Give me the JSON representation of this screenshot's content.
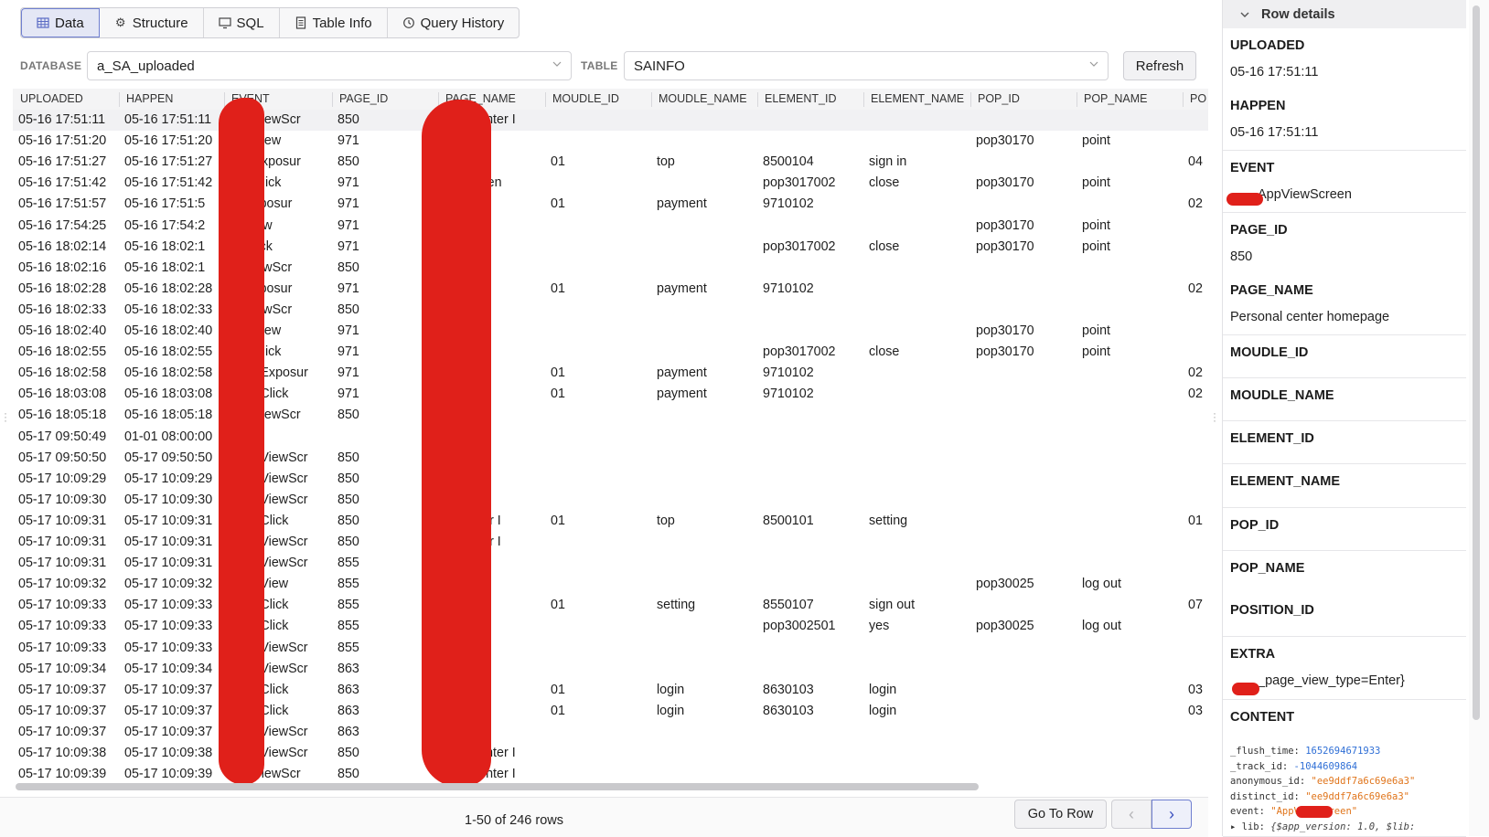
{
  "tabs": [
    {
      "label": "Data",
      "icon": "table-grid-icon"
    },
    {
      "label": "Structure",
      "icon": "gear-icon"
    },
    {
      "label": "SQL",
      "icon": "monitor-icon"
    },
    {
      "label": "Table Info",
      "icon": "document-icon"
    },
    {
      "label": "Query History",
      "icon": "history-icon"
    }
  ],
  "filters": {
    "database_label": "DATABASE",
    "database_value": "a_SA_uploaded",
    "table_label": "TABLE",
    "table_value": "SAINFO",
    "refresh_label": "Refresh"
  },
  "columns": [
    "UPLOADED",
    "HAPPEN",
    "EVENT",
    "PAGE_ID",
    "PAGE_NAME",
    "MOUDLE_ID",
    "MOUDLE_NAME",
    "ELEMENT_ID",
    "ELEMENT_NAME",
    "POP_ID",
    "POP_NAME",
    "PO"
  ],
  "rows": [
    [
      "05-16 17:51:11",
      "05-16 17:51:11",
      "AppViewScr",
      "850",
      "onal center I",
      "",
      "",
      "",
      "",
      "",
      "",
      ""
    ],
    [
      "05-16 17:51:20",
      "05-16 17:51:20",
      "PopView",
      "971",
      "payme",
      "",
      "",
      "",
      "",
      "pop30170",
      "point",
      ""
    ],
    [
      "05-16 17:51:27",
      "05-16 17:51:27",
      "AppExposur",
      "850",
      "center I",
      "01",
      "top",
      "8500104",
      "sign in",
      "",
      "",
      "04"
    ],
    [
      "05-16 17:51:42",
      "05-16 17:51:42",
      "PopClick",
      "971",
      "rt paymen",
      "",
      "",
      "pop3017002",
      "close",
      "pop30170",
      "point",
      ""
    ],
    [
      "05-16 17:51:57",
      "05-16 17:51:5",
      "ppExposur",
      "971",
      "paymen",
      "01",
      "payment",
      "9710102",
      "",
      "",
      "",
      "02"
    ],
    [
      "05-16 17:54:25",
      "05-16 17:54:2",
      "opView",
      "971",
      "aymen",
      "",
      "",
      "",
      "",
      "pop30170",
      "point",
      ""
    ],
    [
      "05-16 18:02:14",
      "05-16 18:02:1",
      "opClick",
      "971",
      "aymen",
      "",
      "",
      "pop3017002",
      "close",
      "pop30170",
      "point",
      ""
    ],
    [
      "05-16 18:02:16",
      "05-16 18:02:1",
      "ppViewScr",
      "850",
      "enter I",
      "",
      "",
      "",
      "",
      "",
      "",
      ""
    ],
    [
      "05-16 18:02:28",
      "05-16 18:02:28",
      "opExposur",
      "971",
      "paymen",
      "01",
      "payment",
      "9710102",
      "",
      "",
      "",
      "02"
    ],
    [
      "05-16 18:02:33",
      "05-16 18:02:33",
      "ppViewScr",
      "850",
      "center I",
      "",
      "",
      "",
      "",
      "",
      "",
      ""
    ],
    [
      "05-16 18:02:40",
      "05-16 18:02:40",
      "PopView",
      "971",
      "paymen",
      "",
      "",
      "",
      "",
      "pop30170",
      "point",
      ""
    ],
    [
      "05-16 18:02:55",
      "05-16 18:02:55",
      "PopClick",
      "971",
      "paymen",
      "",
      "",
      "pop3017002",
      "close",
      "pop30170",
      "point",
      ""
    ],
    [
      "05-16 18:02:58",
      "05-16 18:02:58",
      "_AppExposur",
      "971",
      "paymen",
      "01",
      "payment",
      "9710102",
      "",
      "",
      "",
      "02"
    ],
    [
      "05-16 18:03:08",
      "05-16 18:03:08",
      "_AppClick",
      "971",
      "paymen",
      "01",
      "payment",
      "9710102",
      "",
      "",
      "",
      "02"
    ],
    [
      "05-16 18:05:18",
      "05-16 18:05:18",
      "AppViewScr",
      "850",
      "center I",
      "",
      "",
      "",
      "",
      "",
      "",
      ""
    ],
    [
      "05-17 09:50:49",
      "01-01 08:00:00",
      "pStart",
      "",
      "",
      "",
      "",
      "",
      "",
      "",
      "",
      ""
    ],
    [
      "05-17 09:50:50",
      "05-17 09:50:50",
      "_AppViewScr",
      "850",
      "center I",
      "",
      "",
      "",
      "",
      "",
      "",
      ""
    ],
    [
      "05-17 10:09:29",
      "05-17 10:09:29",
      "_AppViewScr",
      "850",
      "center I",
      "",
      "",
      "",
      "",
      "",
      "",
      ""
    ],
    [
      "05-17 10:09:30",
      "05-17 10:09:30",
      "_AppViewScr",
      "850",
      "center I",
      "",
      "",
      "",
      "",
      "",
      "",
      ""
    ],
    [
      "05-17 10:09:31",
      "05-17 10:09:31",
      "_AppClick",
      "850",
      "al center I",
      "01",
      "top",
      "8500101",
      "setting",
      "",
      "",
      "01"
    ],
    [
      "05-17 10:09:31",
      "05-17 10:09:31",
      "_AppViewScr",
      "850",
      "al center I",
      "",
      "",
      "",
      "",
      "",
      "",
      ""
    ],
    [
      "05-17 10:09:31",
      "05-17 10:09:31",
      "_AppViewScr",
      "855",
      "page",
      "",
      "",
      "",
      "",
      "",
      "",
      ""
    ],
    [
      "05-17 10:09:32",
      "05-17 10:09:32",
      "_PopView",
      "855",
      "page",
      "",
      "",
      "",
      "",
      "pop30025",
      "log out",
      ""
    ],
    [
      "05-17 10:09:33",
      "05-17 10:09:33",
      "_AppClick",
      "855",
      "page",
      "01",
      "setting",
      "8550107",
      "sign out",
      "",
      "",
      "07"
    ],
    [
      "05-17 10:09:33",
      "05-17 10:09:33",
      "_PopClick",
      "855",
      "page",
      "",
      "",
      "pop3002501",
      "yes",
      "pop30025",
      "log out",
      ""
    ],
    [
      "05-17 10:09:33",
      "05-17 10:09:33",
      "_AppViewScr",
      "855",
      "page",
      "",
      "",
      "",
      "",
      "",
      "",
      ""
    ],
    [
      "05-17 10:09:34",
      "05-17 10:09:34",
      "_AppViewScr",
      "863",
      "age",
      "",
      "",
      "",
      "",
      "",
      "",
      ""
    ],
    [
      "05-17 10:09:37",
      "05-17 10:09:37",
      "_AppClick",
      "863",
      "age",
      "01",
      "login",
      "8630103",
      "login",
      "",
      "",
      "03"
    ],
    [
      "05-17 10:09:37",
      "05-17 10:09:37",
      "_AppClick",
      "863",
      "age",
      "01",
      "login",
      "8630103",
      "login",
      "",
      "",
      "03"
    ],
    [
      "05-17 10:09:37",
      "05-17 10:09:37",
      "_AppViewScr",
      "863",
      "page",
      "",
      "",
      "",
      "",
      "",
      "",
      ""
    ],
    [
      "05-17 10:09:38",
      "05-17 10:09:38",
      "_AppViewScr",
      "850",
      "onal center I",
      "",
      "",
      "",
      "",
      "",
      "",
      ""
    ],
    [
      "05-17 10:09:39",
      "05-17 10:09:39",
      "AppViewScr",
      "850",
      "onal center I",
      "",
      "",
      "",
      "",
      "",
      "",
      ""
    ]
  ],
  "footer": {
    "row_count": "1-50 of 246 rows",
    "goto_label": "Go To Row",
    "prev_icon": "chevron-left-icon",
    "next_icon": "chevron-right-icon"
  },
  "row_details": {
    "title": "Row details",
    "fields": [
      {
        "name": "UPLOADED",
        "value": "05-16 17:51:11"
      },
      {
        "name": "HAPPEN",
        "value": "05-16 17:51:11"
      },
      {
        "name": "EVENT",
        "value": "AppViewScreen"
      },
      {
        "name": "PAGE_ID",
        "value": "850"
      },
      {
        "name": "PAGE_NAME",
        "value": "Personal center homepage"
      },
      {
        "name": "MOUDLE_ID",
        "value": ""
      },
      {
        "name": "MOUDLE_NAME",
        "value": ""
      },
      {
        "name": "ELEMENT_ID",
        "value": ""
      },
      {
        "name": "ELEMENT_NAME",
        "value": ""
      },
      {
        "name": "POP_ID",
        "value": ""
      },
      {
        "name": "POP_NAME",
        "value": ""
      },
      {
        "name": "POSITION_ID",
        "value": ""
      },
      {
        "name": "EXTRA",
        "value": "_page_view_type=Enter}"
      },
      {
        "name": "CONTENT",
        "value": ""
      }
    ],
    "content_lines": [
      {
        "key": "_flush_time: ",
        "val": "1652694671933",
        "kind": "n"
      },
      {
        "key": "_track_id: ",
        "val": "-1044609864",
        "kind": "n"
      },
      {
        "key": "anonymous_id: ",
        "val": "\"ee9ddf7a6c69e6a3\"",
        "kind": "s"
      },
      {
        "key": "distinct_id: ",
        "val": "\"ee9ddf7a6c69e6a3\"",
        "kind": "s"
      },
      {
        "key": "event: ",
        "val": "\"AppViewScreen\"",
        "kind": "s"
      },
      {
        "key": "▸ lib: ",
        "val": "{$app_version: 1.0, $lib:",
        "kind": "k"
      }
    ]
  },
  "colors": {
    "accent": "#6f7fd0",
    "redaction": "#e0201a",
    "number": "#2f6fd6",
    "string": "#e0741a"
  }
}
